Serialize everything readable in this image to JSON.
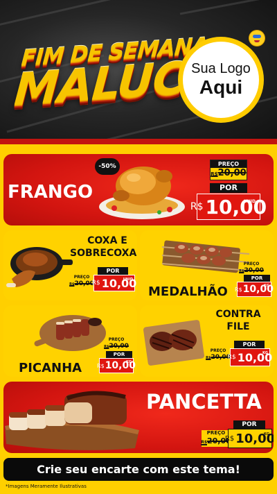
{
  "header": {
    "title_line1": "FIM DE SEMANA",
    "title_line2": "MALUCO",
    "logo_line1": "Sua Logo",
    "logo_line2": "Aqui"
  },
  "products": [
    {
      "name": "FRANGO",
      "discount": "-50%",
      "price_label": "PREÇO",
      "old_currency": "R$",
      "old_price": "20,00",
      "por_label": "POR",
      "currency": "R$",
      "price": "10,00",
      "unit": "UNID"
    },
    {
      "name_line1": "COXA E",
      "name_line2": "SOBRECOXA",
      "price_label": "PREÇO",
      "old_currency": "R$",
      "old_price": "20,00",
      "por_label": "POR",
      "currency": "R$",
      "price": "10,00",
      "unit": "UNID"
    },
    {
      "name": "MEDALHÃO",
      "price_label": "PREÇO",
      "old_currency": "R$",
      "old_price": "20,00",
      "por_label": "POR",
      "currency": "R$",
      "price": "10,00",
      "unit": "KG"
    },
    {
      "name": "PICANHA",
      "price_label": "PREÇO",
      "old_currency": "R$",
      "old_price": "20,00",
      "por_label": "POR",
      "currency": "R$",
      "price": "10,00",
      "unit": "KG"
    },
    {
      "name_line1": "CONTRA",
      "name_line2": "FILE",
      "price_label": "PREÇO",
      "old_currency": "R$",
      "old_price": "20,00",
      "por_label": "POR",
      "currency": "R$",
      "price": "10,00",
      "unit": "KG"
    },
    {
      "name": "PANCETTA",
      "price_label": "PREÇO",
      "old_currency": "R$",
      "old_price": "20,00",
      "por_label": "POR",
      "currency": "R$",
      "price": "10,00",
      "unit": "KG"
    }
  ],
  "cta": "Crie seu encarte com este tema!",
  "footnote": "*Imagens Meramente Ilustrativas",
  "colors": {
    "red": "#d8160f",
    "yellow": "#ffd200",
    "black": "#111111"
  }
}
